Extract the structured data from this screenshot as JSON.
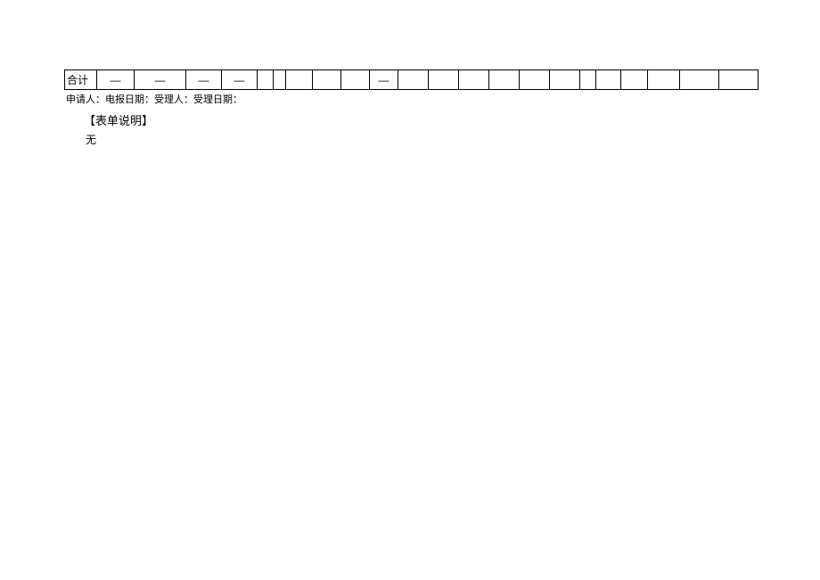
{
  "table": {
    "row": {
      "c0": "合计",
      "c1": "—",
      "c2": "—",
      "c3": "—",
      "c4": "—",
      "c5": "",
      "c6": "",
      "c7": "",
      "c8": "",
      "c9": "",
      "c10": "—",
      "c11": "",
      "c12": "",
      "c13": "",
      "c14": "",
      "c15": "",
      "c16": "",
      "c17": "",
      "c18": "",
      "c19": "",
      "c20": "",
      "c21": "",
      "c22": ""
    }
  },
  "meta": {
    "line": "申请人：电报日期：受理人：受理日期："
  },
  "section": {
    "title": "【表单说明】",
    "body": "无"
  }
}
